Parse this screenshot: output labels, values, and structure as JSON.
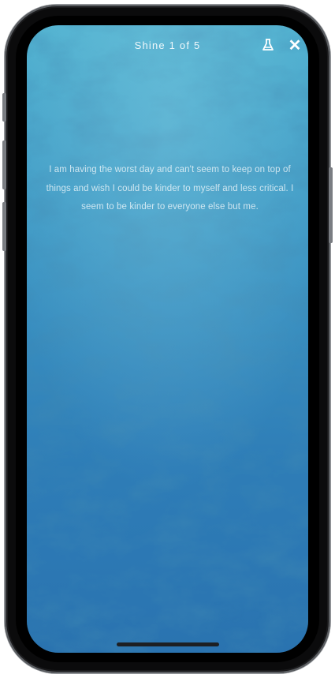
{
  "header": {
    "title": "Shine 1 of 5",
    "flask_icon": "flask-icon",
    "close_icon": "close-icon",
    "close_glyph": "✕"
  },
  "message": {
    "text": "I am having the worst day and can't seem to keep on top of things and wish I could be kinder to myself and less critical. I seem to be kinder to everyone else but me."
  },
  "colors": {
    "background_top": "#4fb0cf",
    "background_bottom": "#2a73b0",
    "text": "#ffffff"
  }
}
